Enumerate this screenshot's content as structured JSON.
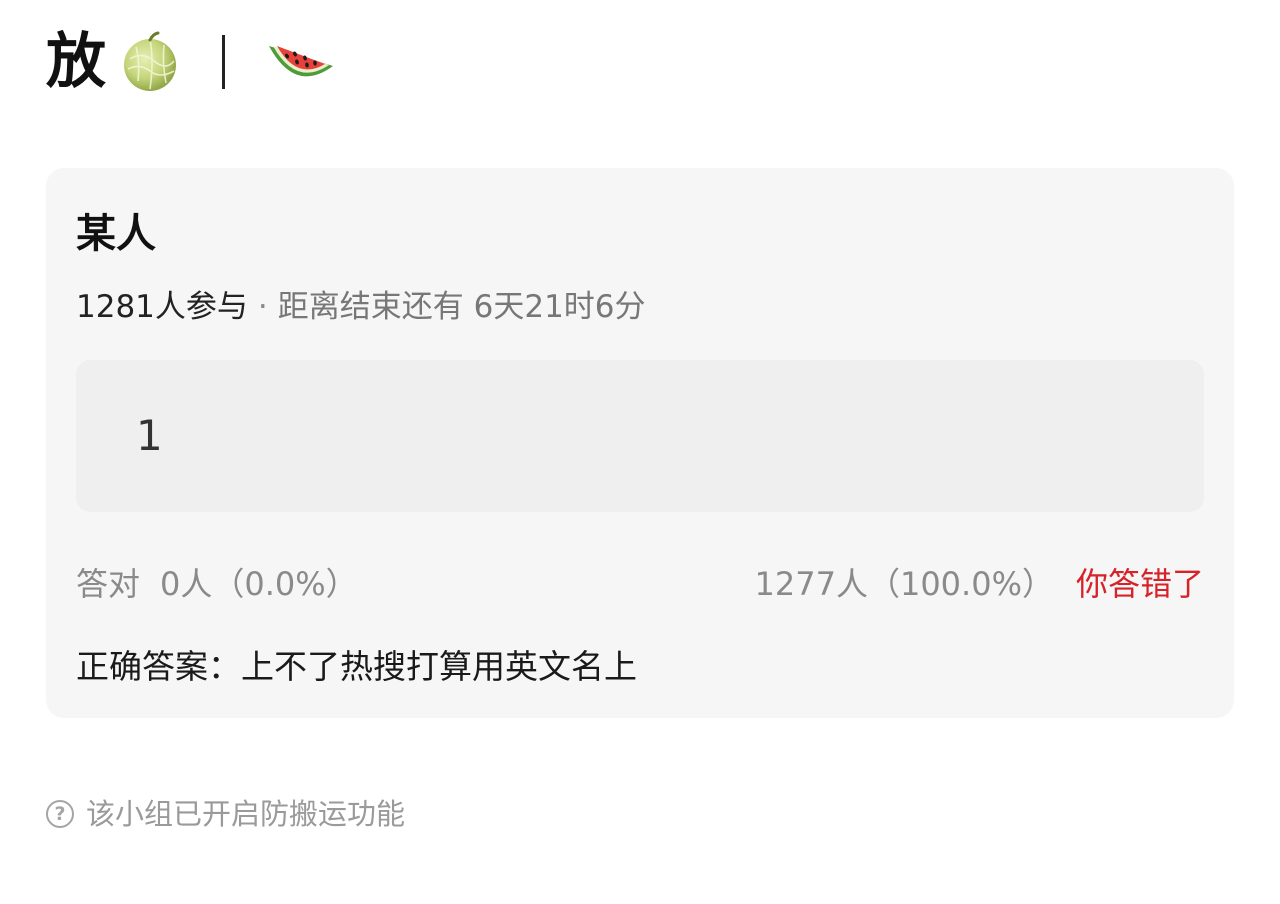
{
  "header": {
    "title": "放",
    "icons": [
      "melon-icon",
      "watermelon-icon"
    ]
  },
  "quiz": {
    "title": "某人",
    "participants": "1281人参与",
    "separator": "·",
    "countdown": "距离结束还有 6天21时6分",
    "option": "1",
    "correct_label": "答对",
    "correct_count": "0人（0.0%）",
    "wrong_count": "1277人（100.0%）",
    "wrong_status": "你答错了",
    "answer": "正确答案：上不了热搜打算用英文名上"
  },
  "footer": {
    "help_symbol": "?",
    "notice": "该小组已开启防搬运功能"
  },
  "colors": {
    "card_background": "#f6f6f6",
    "wrong_status": "#d6232a",
    "muted_text": "#8a8a8a"
  }
}
